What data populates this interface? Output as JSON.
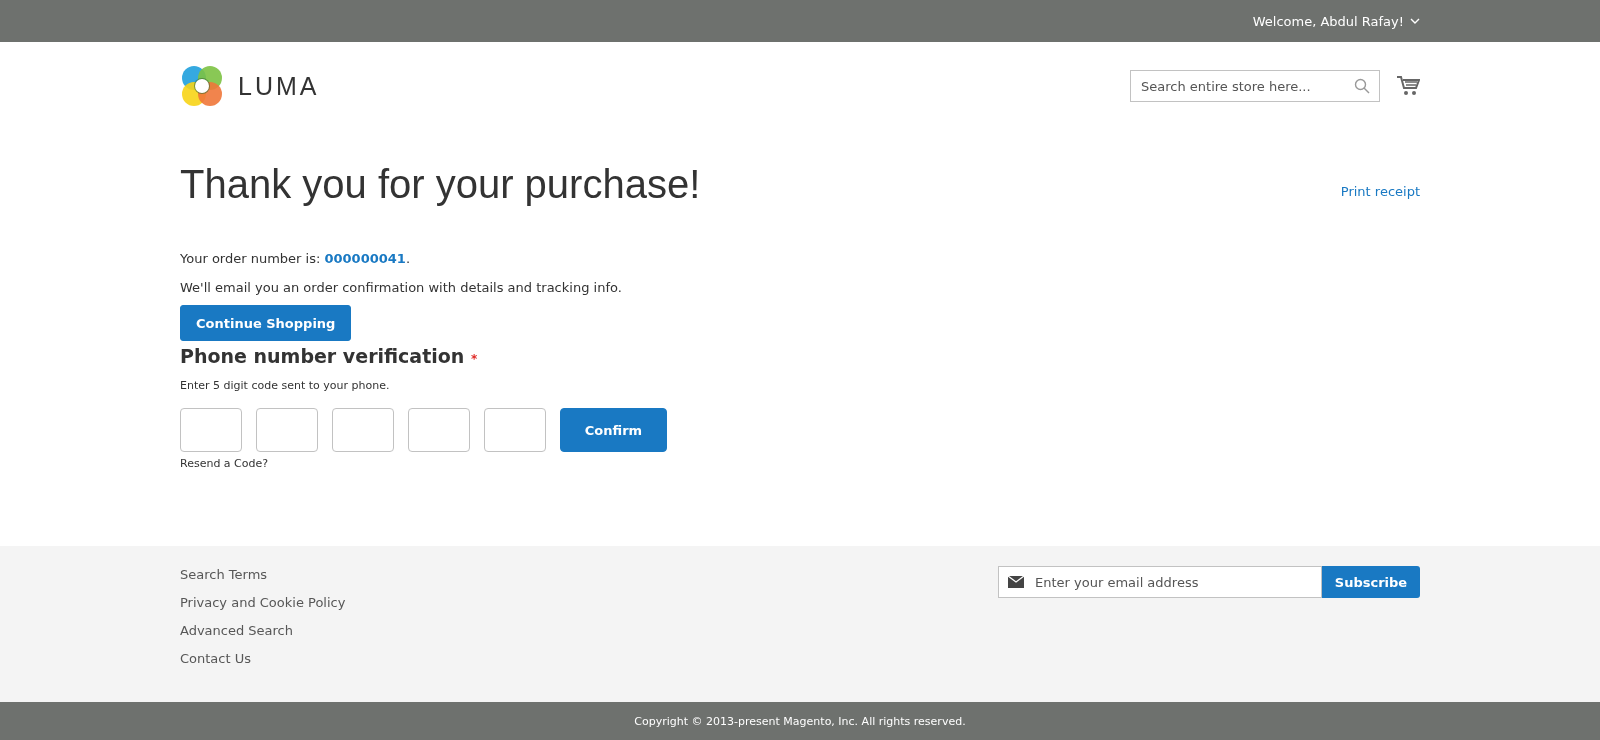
{
  "top_bar": {
    "welcome": "Welcome, Abdul Rafay!"
  },
  "header": {
    "logo_text": "LUMA",
    "search": {
      "placeholder": "Search entire store here..."
    }
  },
  "page_title": "Thank you for your purchase!",
  "print_link": "Print receipt",
  "order": {
    "prefix": "Your order number is:",
    "number": "000000041",
    "suffix": "."
  },
  "email_note": "We'll email you an order confirmation with details and tracking info.",
  "continue_button": "Continue Shopping",
  "verification": {
    "title": "Phone number verification",
    "required_mark": "*",
    "hint": "Enter 5 digit code sent to your phone.",
    "code_fields": [
      {
        "focused": false
      },
      {
        "focused": false
      },
      {
        "focused": false
      },
      {
        "focused": false
      },
      {
        "focused": false
      }
    ],
    "confirm_button": "Confirm",
    "resend_link": "Resend a Code?"
  },
  "footer": {
    "links": [
      "Search Terms",
      "Privacy and Cookie Policy",
      "Advanced Search",
      "Contact Us"
    ],
    "newsletter": {
      "placeholder": "Enter your email address",
      "button": "Subscribe"
    }
  },
  "copyright": "Copyright © 2013-present Magento, Inc. All rights reserved."
}
